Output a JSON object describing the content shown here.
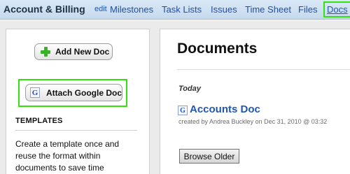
{
  "header": {
    "project_title": "Account & Billing",
    "edit_link": "edit",
    "tabs": [
      {
        "label": "Milestones"
      },
      {
        "label": "Task Lists"
      },
      {
        "label": "Issues"
      },
      {
        "label": "Time Sheet"
      },
      {
        "label": "Files"
      },
      {
        "label": "Docs",
        "active": true
      }
    ]
  },
  "sidebar": {
    "add_button_label": "Add New Doc",
    "attach_button_label": "Attach Google Doc",
    "attach_icon_glyph": "G",
    "templates_heading": "TEMPLATES",
    "templates_text": "Create a template once and reuse the format within documents to save time"
  },
  "main": {
    "title": "Documents",
    "group_label": "Today",
    "documents": [
      {
        "icon_glyph": "G",
        "title": "Accounts Doc",
        "meta": "created by Andrea Buckley on Dec 31, 2010 @ 03:32"
      }
    ],
    "browse_button_label": "Browse Older"
  },
  "colors": {
    "highlight": "#33e10c",
    "link": "#1f56b3",
    "topbar": "#c6daee",
    "page_bg": "#ebebeb"
  }
}
